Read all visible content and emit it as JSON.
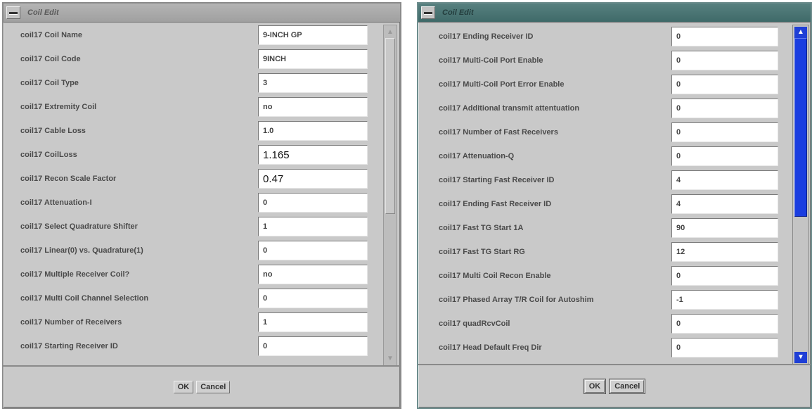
{
  "left": {
    "title": "Coil Edit",
    "rows": [
      {
        "label": "coil17 Coil Name",
        "value": "9-INCH GP"
      },
      {
        "label": "coil17 Coil Code",
        "value": "9INCH"
      },
      {
        "label": "coil17 Coil Type",
        "value": "3"
      },
      {
        "label": "coil17 Extremity Coil",
        "value": "no"
      },
      {
        "label": "coil17 Cable Loss",
        "value": "1.0"
      },
      {
        "label": "coil17 CoilLoss",
        "value": "1.165"
      },
      {
        "label": "coil17 Recon Scale Factor",
        "value": "0.47"
      },
      {
        "label": "coil17 Attenuation-I",
        "value": "0"
      },
      {
        "label": "coil17 Select Quadrature Shifter",
        "value": "1"
      },
      {
        "label": "coil17 Linear(0) vs. Quadrature(1)",
        "value": "0"
      },
      {
        "label": "coil17 Multiple Receiver Coil?",
        "value": "no"
      },
      {
        "label": "coil17 Multi Coil Channel Selection",
        "value": "0"
      },
      {
        "label": "coil17 Number of Receivers",
        "value": "1"
      },
      {
        "label": "coil17 Starting Receiver ID",
        "value": "0"
      }
    ],
    "ok_label": "OK",
    "cancel_label": "Cancel"
  },
  "right": {
    "title": "Coil Edit",
    "rows": [
      {
        "label": "coil17 Ending Receiver ID",
        "value": "0"
      },
      {
        "label": "coil17 Multi-Coil Port Enable",
        "value": "0"
      },
      {
        "label": "coil17 Multi-Coil Port Error Enable",
        "value": "0"
      },
      {
        "label": "coil17 Additional transmit attentuation",
        "value": "0"
      },
      {
        "label": "coil17 Number of Fast Receivers",
        "value": "0"
      },
      {
        "label": "coil17 Attenuation-Q",
        "value": "0"
      },
      {
        "label": "coil17 Starting Fast Receiver ID",
        "value": "4"
      },
      {
        "label": "coil17 Ending Fast Receiver ID",
        "value": "4"
      },
      {
        "label": "coil17 Fast TG Start 1A",
        "value": "90"
      },
      {
        "label": "coil17 Fast TG Start RG",
        "value": "12"
      },
      {
        "label": "coil17 Multi Coil Recon Enable",
        "value": "0"
      },
      {
        "label": "coil17 Phased Array T/R Coil for Autoshim",
        "value": "-1"
      },
      {
        "label": "coil17 quadRcvCoil",
        "value": "0"
      },
      {
        "label": "coil17 Head Default Freq Dir",
        "value": "0"
      }
    ],
    "ok_label": "OK",
    "cancel_label": "Cancel"
  },
  "colors": {
    "panel": "#c9c9c9",
    "right_title_bar": "#4a7473",
    "scroll_blue": "#1a3de0"
  }
}
